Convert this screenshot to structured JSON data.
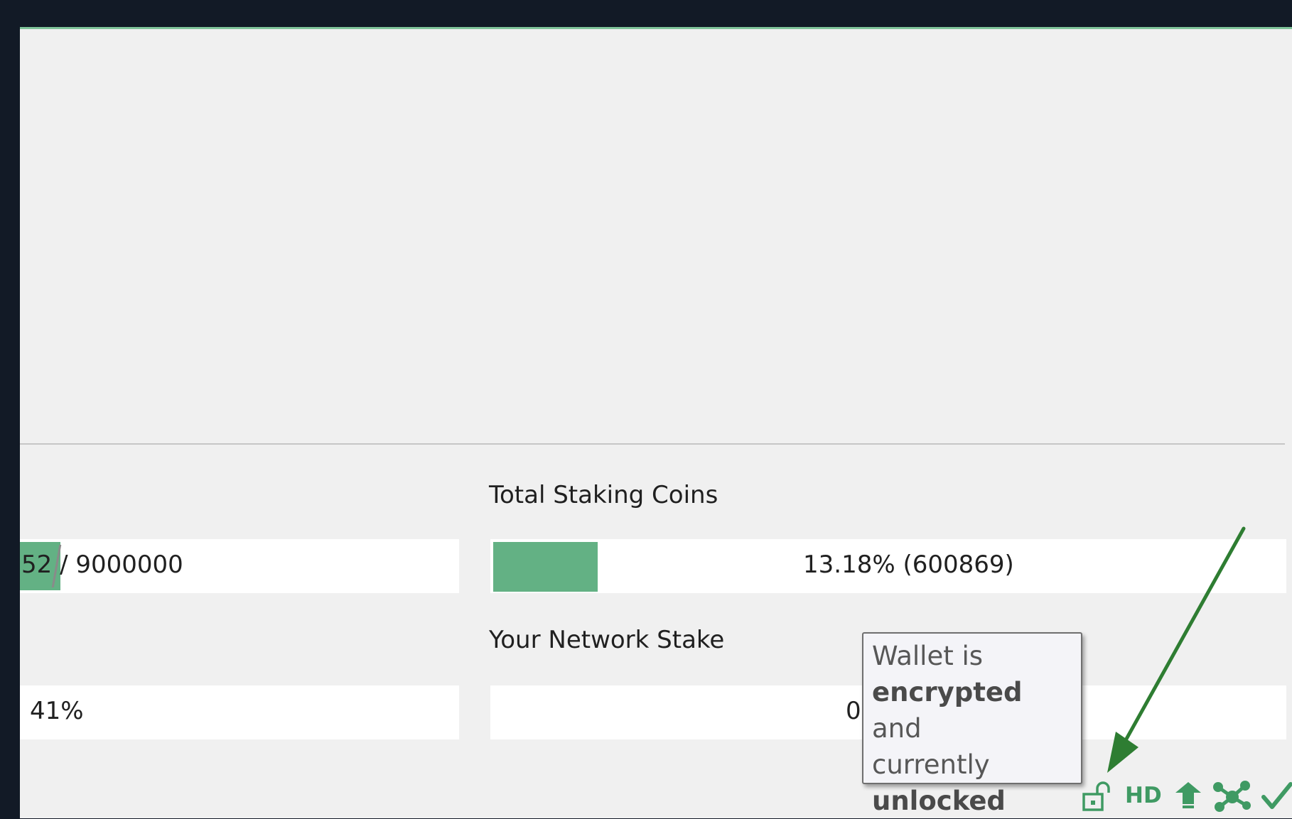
{
  "panels": {
    "left": {
      "progress_text": "52 / 9000000",
      "percent_text": "41%"
    },
    "staking": {
      "title": "Total Staking Coins",
      "value_text": "13.18% (600869)",
      "fill_fraction": 0.1318
    },
    "network_stake": {
      "title": "Your Network Stake",
      "value_text": "0"
    }
  },
  "tooltip": {
    "line1": "Wallet is",
    "bold1": "encrypted",
    "after_bold1": " and",
    "line3": "currently",
    "bold2": "unlocked"
  },
  "status_bar": {
    "hd_label": "HD",
    "icons": [
      "unlocked-padlock-icon",
      "hd-icon",
      "staking-icon",
      "network-icon",
      "synced-check-icon"
    ],
    "accent_color": "#3f9a63"
  },
  "colors": {
    "progress_fill": "#63b184",
    "annotation_arrow": "#2e7d32"
  }
}
